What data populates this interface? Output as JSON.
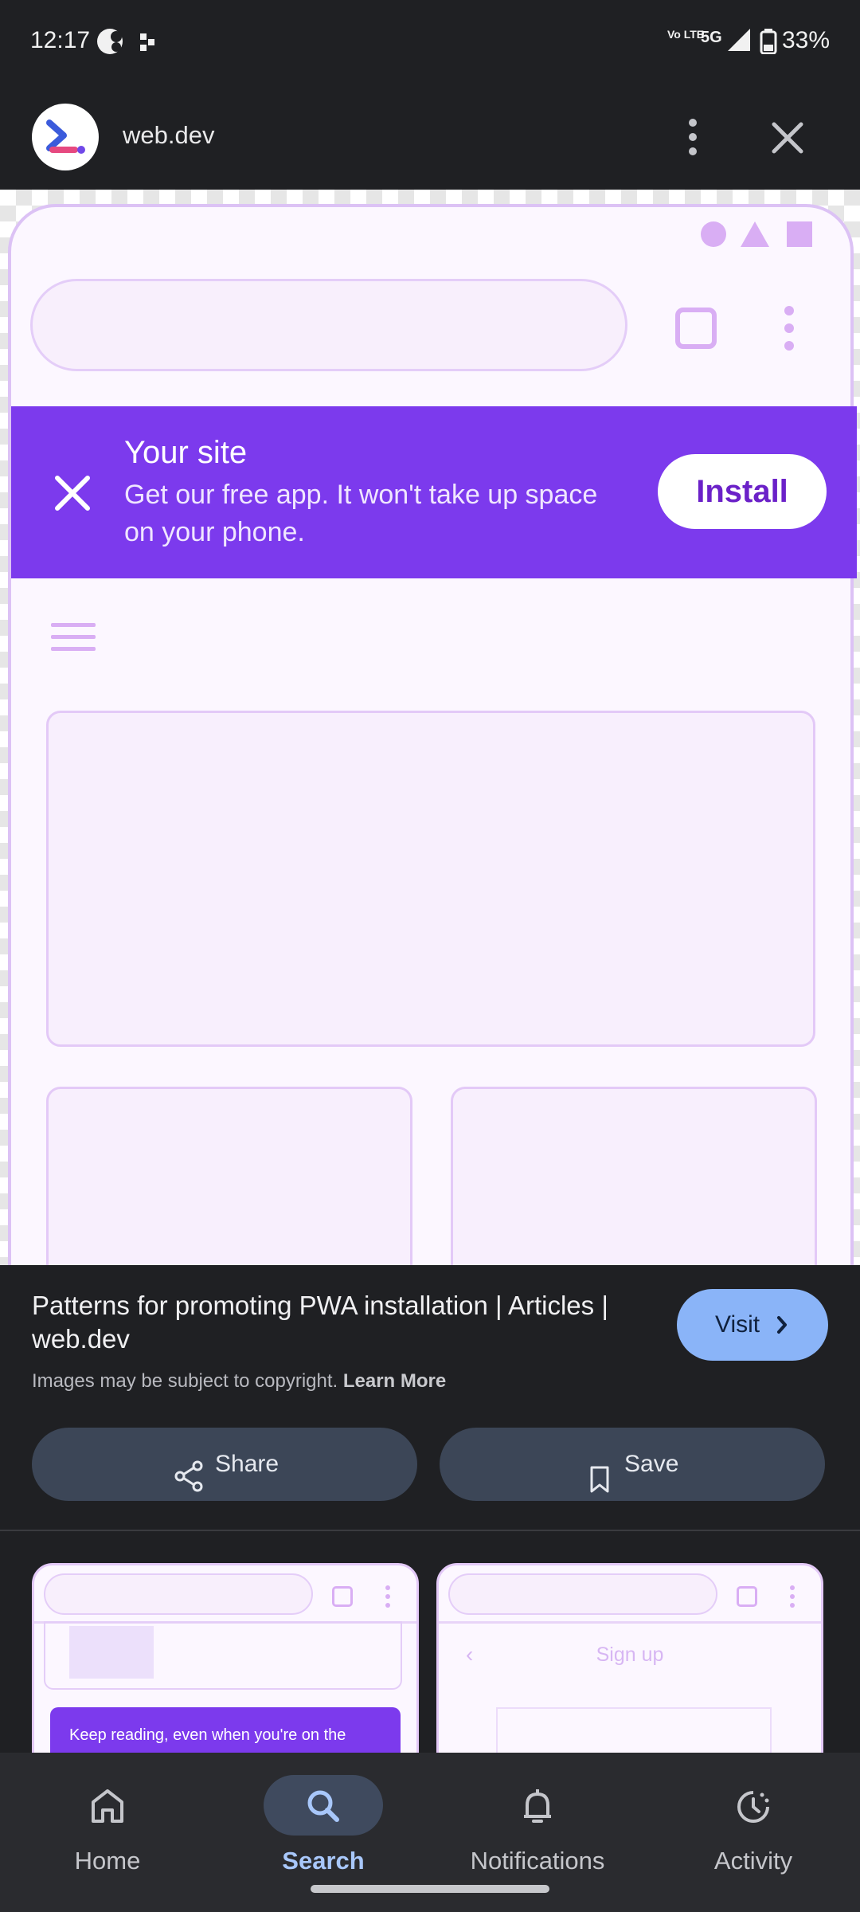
{
  "status_bar": {
    "time": "12:17",
    "network": "5G",
    "volte": "Vo LTE",
    "battery": "33%"
  },
  "header": {
    "site_name": "web.dev",
    "icons": [
      "web-dev-logo",
      "more-vert-icon",
      "close-icon"
    ]
  },
  "preview": {
    "banner_title": "Your site",
    "banner_text": "Get our free app. It won't take up space on your phone.",
    "install_label": "Install"
  },
  "result": {
    "title": "Patterns for promoting PWA installation | Articles | web.dev",
    "visit_label": "Visit",
    "copyright_note": "Images may be subject to copyright.",
    "learn_more": "Learn More",
    "share_label": "Share",
    "save_label": "Save"
  },
  "thumbnails": [
    {
      "banner_text": "Keep reading, even when you're on the"
    },
    {
      "title": "Sign up"
    }
  ],
  "nav": {
    "items": [
      {
        "label": "Home",
        "icon": "home-icon"
      },
      {
        "label": "Search",
        "icon": "search-icon",
        "selected": true
      },
      {
        "label": "Notifications",
        "icon": "bell-icon"
      },
      {
        "label": "Activity",
        "icon": "activity-icon"
      }
    ]
  },
  "colors": {
    "accent_purple": "#7c3aed",
    "visit_blue": "#8ab4f8",
    "background": "#1f2023"
  }
}
